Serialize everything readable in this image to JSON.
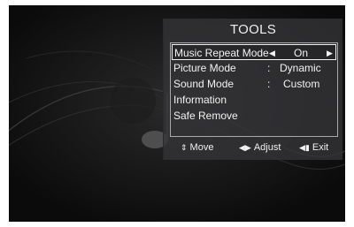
{
  "menu": {
    "title": "TOOLS",
    "items": [
      {
        "label": "Music Repeat Mode",
        "value": "On",
        "selected": true
      },
      {
        "label": "Picture Mode",
        "value": "Dynamic"
      },
      {
        "label": "Sound Mode",
        "value": "Custom"
      },
      {
        "label": "Information"
      },
      {
        "label": "Safe Remove"
      }
    ],
    "colon": ":",
    "footer": {
      "move": "Move",
      "adjust": "Adjust",
      "exit": "Exit"
    }
  }
}
